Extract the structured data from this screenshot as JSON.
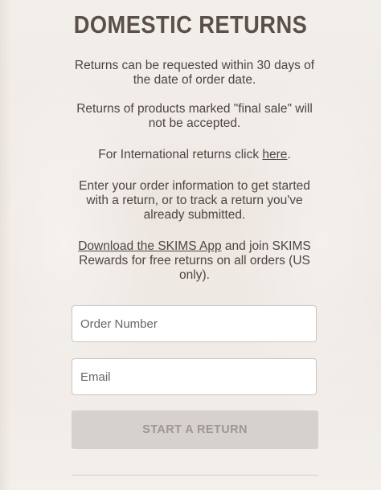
{
  "page": {
    "title": "DOMESTIC RETURNS",
    "p1": "Returns can be requested within 30 days of the date of order date.",
    "p2": "Returns of products marked \"final sale\" will not be accepted.",
    "p3_prefix": "For International returns click ",
    "p3_link": "here",
    "p3_suffix": ".",
    "p4": "Enter your order information to get started with a return, or to track a return you've already submitted.",
    "p5_link": "Download the SKIMS App",
    "p5_suffix": " and join SKIMS Rewards for free returns on all orders (US only)."
  },
  "form": {
    "order_number_placeholder": "Order Number",
    "email_placeholder": "Email",
    "submit_label": "START A RETURN"
  },
  "colors": {
    "background": "#f1ece8",
    "title": "#5b4f49",
    "button_disabled": "#d6d1ce"
  }
}
